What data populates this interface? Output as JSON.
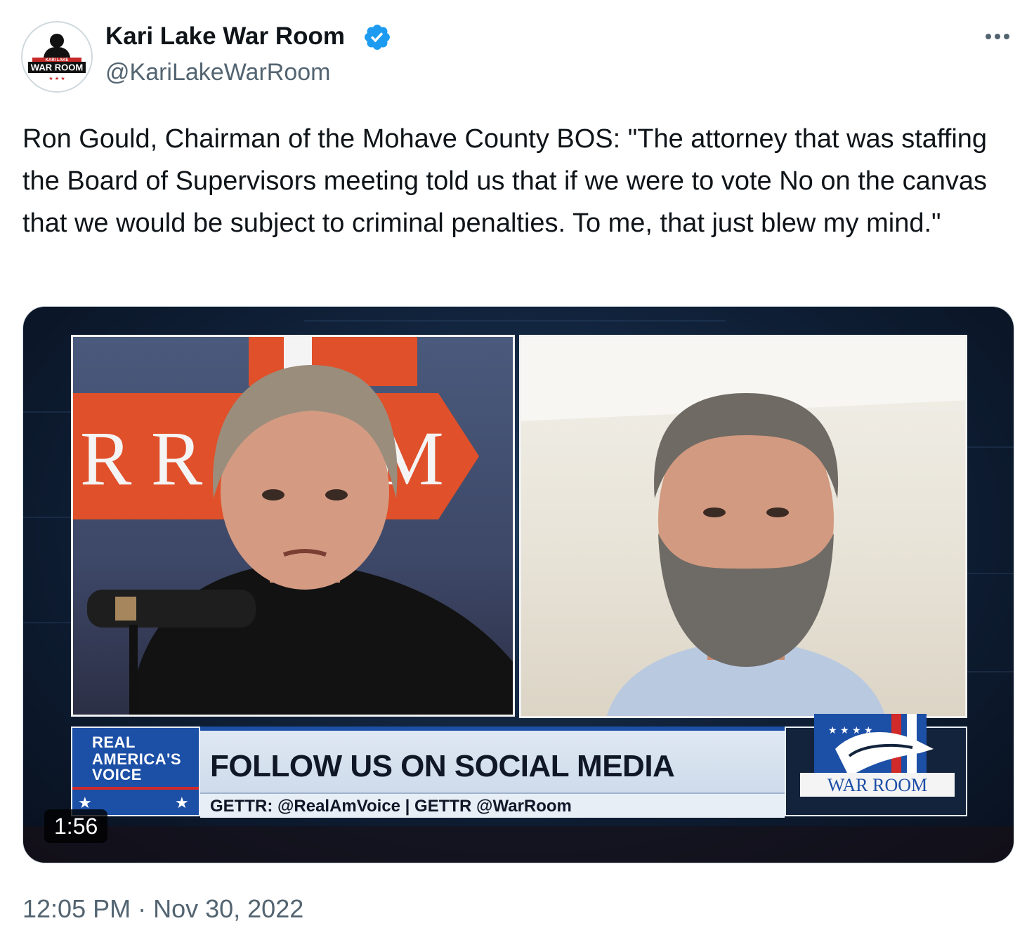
{
  "author": {
    "display_name": "Kari Lake War Room",
    "handle": "@KariLakeWarRoom",
    "verified": true,
    "avatar_text_top": "KARI LAKE",
    "avatar_text_main": "WAR ROOM"
  },
  "tweet": {
    "text": "Ron Gould, Chairman of the Mohave County BOS: \"The attorney that was staffing the Board of Supervisors meeting told us that if we were to vote No on the canvas that we would be subject to criminal penalties. To me, that just blew my mind.\"",
    "timestamp": "12:05 PM · Nov 30, 2022"
  },
  "media": {
    "duration": "1:56",
    "left_backdrop_text": "R R",
    "left_backdrop_text_end": "M",
    "lower_third": {
      "rav_line1": "REAL",
      "rav_line2": "AMERICA'S",
      "rav_line3": "VOICE",
      "headline": "FOLLOW US ON SOCIAL MEDIA",
      "subline": "GETTR: @RealAmVoice | GETTR @WarRoom",
      "logo_text": "WAR ROOM"
    }
  },
  "icons": {
    "verified": "verified-badge-icon",
    "more": "more-options-icon"
  },
  "colors": {
    "verified_blue": "#1d9bf0",
    "secondary_text": "#536471",
    "primary_text": "#0f1419",
    "rav_blue": "#1c4fa6",
    "warroom_red": "#d12a2a"
  }
}
